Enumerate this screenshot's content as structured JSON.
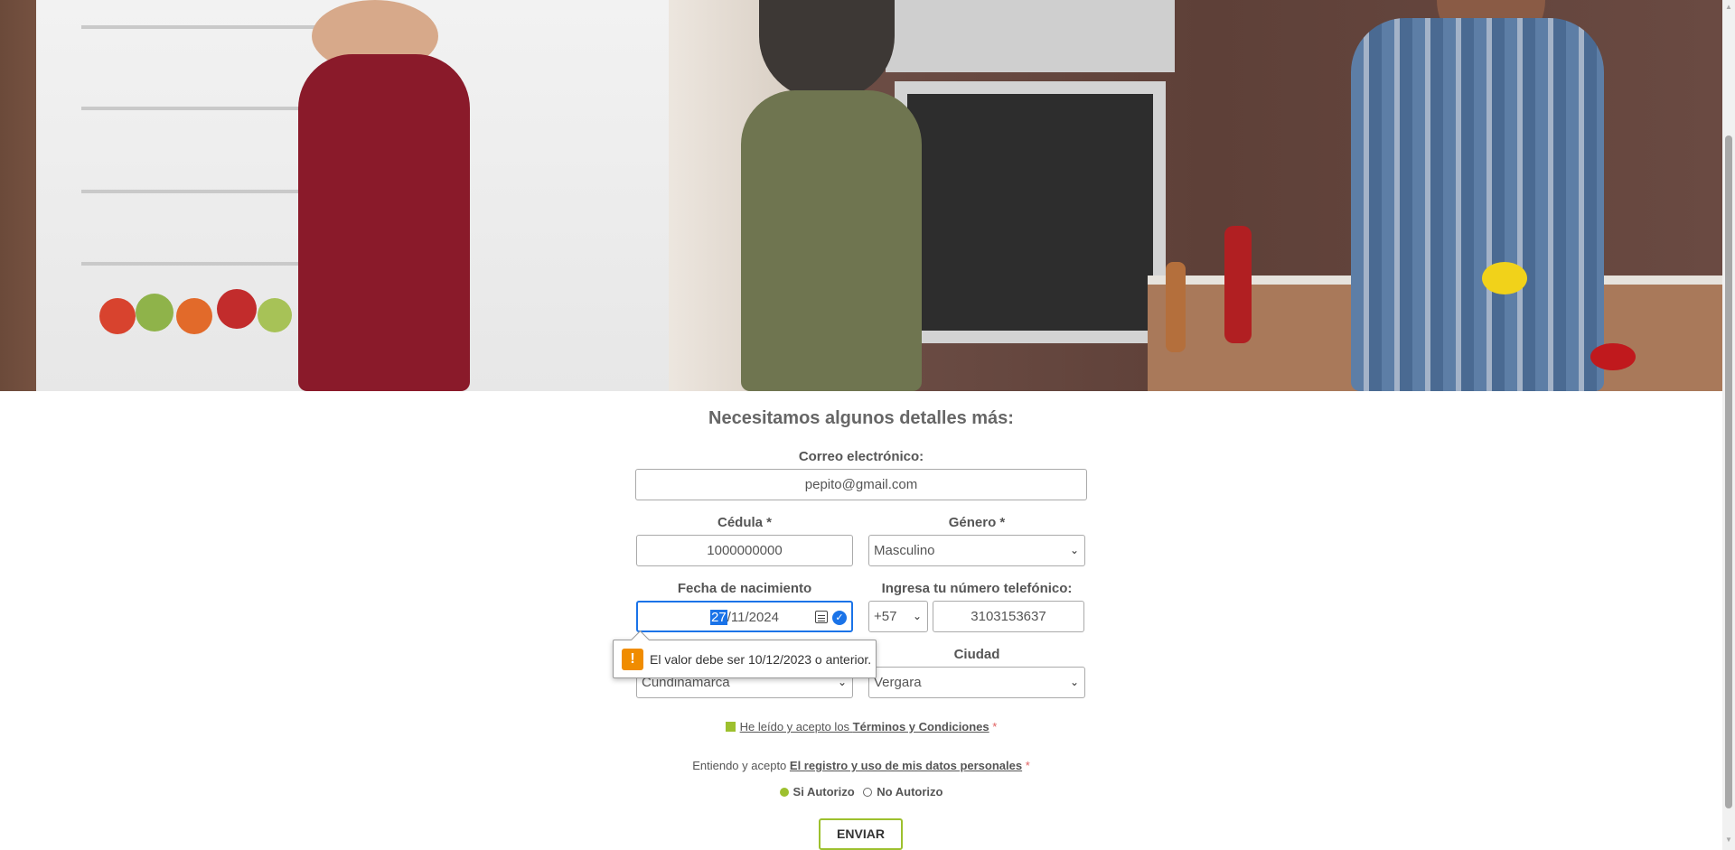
{
  "form": {
    "title": "Necesitamos algunos detalles más:",
    "email_label": "Correo electrónico:",
    "email_value": "pepito@gmail.com",
    "cedula_label": "Cédula",
    "cedula_value": "1000000000",
    "genero_label": "Género",
    "genero_value": "Masculino",
    "required_mark": "*",
    "birth_label": "Fecha de nacimiento",
    "birth_day": "27",
    "birth_rest": "/11/2024",
    "phone_label": "Ingresa tu número telefónico:",
    "phone_prefix": "+57",
    "phone_value": "3103153637",
    "department_value": "Cundinamarca",
    "city_label": "Ciudad",
    "city_value": "Vergara"
  },
  "validation": {
    "message": "El valor debe ser 10/12/2023 o anterior."
  },
  "terms": {
    "prefix": "He leído y acepto los",
    "link": "Términos y Condiciones",
    "star": "*"
  },
  "data_policy": {
    "prefix": "Entiendo y acepto",
    "link": "El registro y uso de mis datos personales",
    "star": "*",
    "option_yes": "Si Autorizo",
    "option_no": "No Autorizo"
  },
  "submit_label": "ENVIAR",
  "colors": {
    "accent_green": "#9dc02e",
    "focus_blue": "#1a73e8",
    "warning_orange": "#f08c00"
  }
}
